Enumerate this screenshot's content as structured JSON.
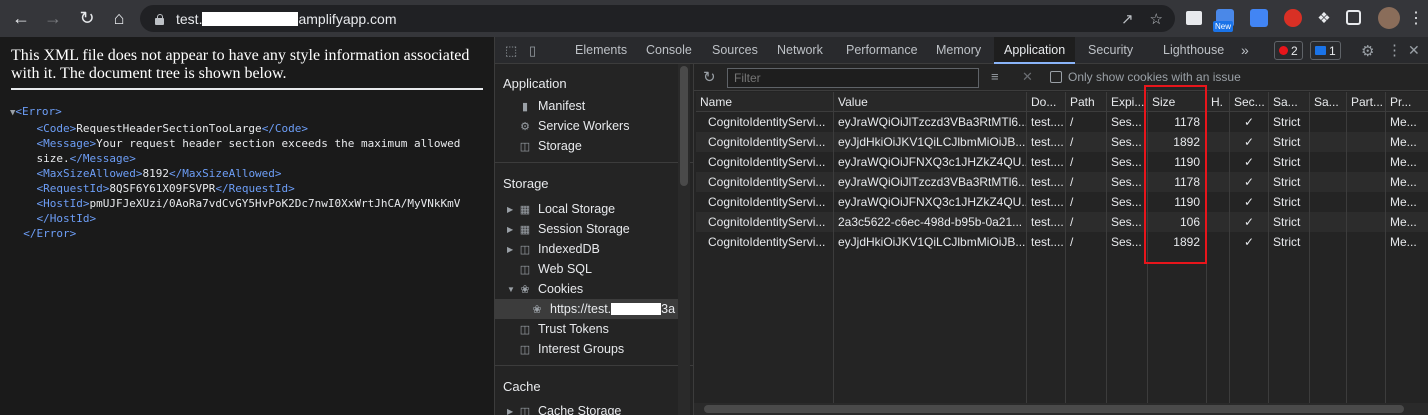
{
  "browser": {
    "url_prefix": "test.",
    "url_suffix": "amplifyapp.com",
    "new_badge": "New"
  },
  "xml_page": {
    "notice": "This XML file does not appear to have any style information associated with it. The document tree is shown below.",
    "tree": {
      "error_open": "<Error>",
      "code_open": "<Code>",
      "code_value": "RequestHeaderSectionTooLarge",
      "code_close": "</Code>",
      "message_open": "<Message>",
      "message_value": "Your request header section exceeds the maximum allowed",
      "message_value_2": "size.",
      "message_close": "</Message>",
      "max_open": "<MaxSizeAllowed>",
      "max_value": "8192",
      "max_close": "</MaxSizeAllowed>",
      "rid_open": "<RequestId>",
      "rid_value": "8QSF6Y61X09FSVPR",
      "rid_close": "</RequestId>",
      "hostid_open": "<HostId>",
      "hostid_value": "pmUJFJeXUzi/0AoRa7vdCvGY5HvPoK2Dc7nwI0XxWrtJhCA/MyVNkKmV",
      "hostid_close": "</HostId>",
      "error_close": "</Error>"
    }
  },
  "devtools": {
    "tabs": [
      "Elements",
      "Console",
      "Sources",
      "Network",
      "Performance",
      "Memory",
      "Application",
      "Security",
      "Lighthouse"
    ],
    "active_tab": "Application",
    "more_tabs": "»",
    "errors_count": "2",
    "messages_count": "1",
    "sidebar": {
      "application_title": "Application",
      "application_items": [
        "Manifest",
        "Service Workers",
        "Storage"
      ],
      "storage_title": "Storage",
      "storage_items": [
        "Local Storage",
        "Session Storage",
        "IndexedDB",
        "Web SQL",
        "Cookies"
      ],
      "cookie_origin_prefix": "https://test.",
      "cookie_origin_suffix": "3a",
      "storage_items_2": [
        "Trust Tokens",
        "Interest Groups"
      ],
      "cache_title": "Cache",
      "cache_items": [
        "Cache Storage"
      ]
    },
    "filter": {
      "placeholder": "Filter",
      "only_issues_label": "Only show cookies with an issue"
    },
    "table": {
      "columns": [
        "Name",
        "Value",
        "Do...",
        "Path",
        "Expi...",
        "Size",
        "H.",
        "Sec...",
        "Sa...",
        "Sa...",
        "Part...",
        "Pr..."
      ],
      "rows": [
        {
          "name": "CognitoIdentityServi...",
          "value": "eyJraWQiOiJlTzczd3VBa3RtMTl6...",
          "domain": "test....",
          "path": "/",
          "expires": "Ses...",
          "size": "1178",
          "secure": "✓",
          "samesite": "Strict",
          "priority": "Me..."
        },
        {
          "name": "CognitoIdentityServi...",
          "value": "eyJjdHkiOiJKV1QiLCJlbmMiOiJB...",
          "domain": "test....",
          "path": "/",
          "expires": "Ses...",
          "size": "1892",
          "secure": "✓",
          "samesite": "Strict",
          "priority": "Me..."
        },
        {
          "name": "CognitoIdentityServi...",
          "value": "eyJraWQiOiJFNXQ3c1JHZkZ4QU...",
          "domain": "test....",
          "path": "/",
          "expires": "Ses...",
          "size": "1190",
          "secure": "✓",
          "samesite": "Strict",
          "priority": "Me..."
        },
        {
          "name": "CognitoIdentityServi...",
          "value": "eyJraWQiOiJlTzczd3VBa3RtMTl6...",
          "domain": "test....",
          "path": "/",
          "expires": "Ses...",
          "size": "1178",
          "secure": "✓",
          "samesite": "Strict",
          "priority": "Me..."
        },
        {
          "name": "CognitoIdentityServi...",
          "value": "eyJraWQiOiJFNXQ3c1JHZkZ4QU...",
          "domain": "test....",
          "path": "/",
          "expires": "Ses...",
          "size": "1190",
          "secure": "✓",
          "samesite": "Strict",
          "priority": "Me..."
        },
        {
          "name": "CognitoIdentityServi...",
          "value": "2a3c5622-c6ec-498d-b95b-0a21...",
          "domain": "test....",
          "path": "/",
          "expires": "Ses...",
          "size": "106",
          "secure": "✓",
          "samesite": "Strict",
          "priority": "Me..."
        },
        {
          "name": "CognitoIdentityServi...",
          "value": "eyJjdHkiOiJKV1QiLCJlbmMiOiJB...",
          "domain": "test....",
          "path": "/",
          "expires": "Ses...",
          "size": "1892",
          "secure": "✓",
          "samesite": "Strict",
          "priority": "Me..."
        }
      ]
    }
  },
  "colors": {
    "highlight": "#e8151b",
    "xml_tag": "#6d9ef7",
    "active_tab_underline": "#8ab4f8"
  }
}
